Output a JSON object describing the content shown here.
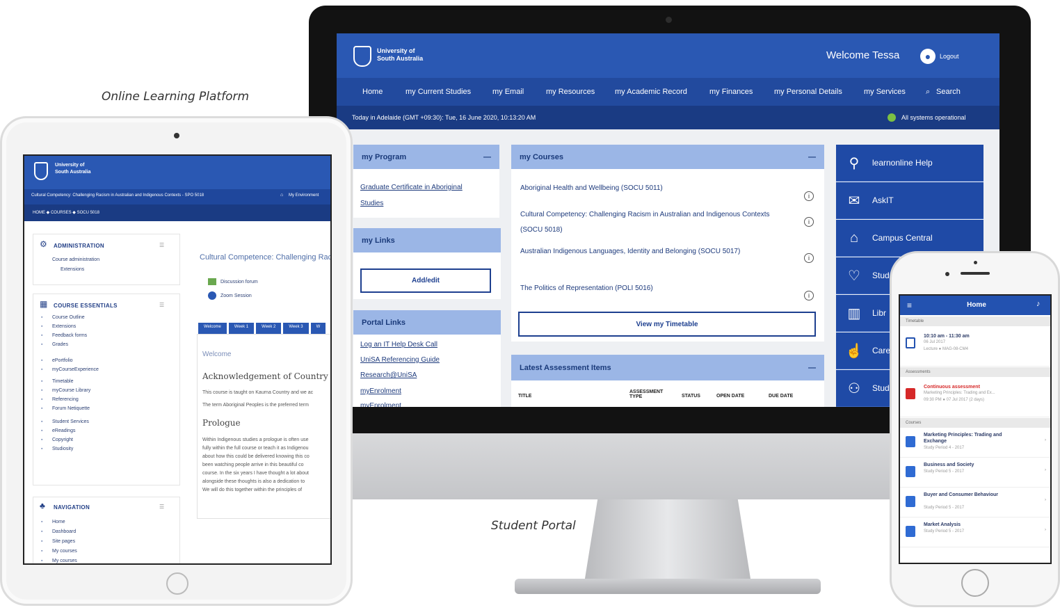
{
  "captions": {
    "online_learning": "Online Learning Platform",
    "student_portal": "Student Portal"
  },
  "portal": {
    "logo_line1": "University of",
    "logo_line2": "South Australia",
    "welcome": "Welcome Tessa",
    "logout": "Logout",
    "nav": [
      "Home",
      "my Current Studies",
      "my Email",
      "my Resources",
      "my Academic Record",
      "my Finances",
      "my Personal Details",
      "my Services",
      "Search"
    ],
    "status_left": "Today in Adelaide (GMT +09:30):   Tue, 16 June 2020, 10:13:20 AM",
    "status_right": "All systems operational",
    "my_program": {
      "title": "my Program",
      "link": "Graduate Certificate in Aboriginal Studies"
    },
    "my_links": {
      "title": "my Links",
      "button": "Add/edit"
    },
    "portal_links": {
      "title": "Portal Links",
      "items": [
        "Log an IT Help Desk Call",
        "UniSA Referencing Guide",
        "Research@UniSA",
        "myEnrolment",
        "myEnrolment"
      ]
    },
    "my_courses": {
      "title": "my Courses",
      "items": [
        "Aboriginal Health and Wellbeing (SOCU 5011)",
        "Cultural Competency: Challenging Racism in Australian and Indigenous Contexts (SOCU 5018)",
        "Australian Indigenous Languages, Identity and Belonging (SOCU 5017)",
        "The Politics of Representation (POLI 5016)"
      ],
      "button": "View my Timetable"
    },
    "assessment": {
      "title": "Latest Assessment Items",
      "columns": [
        "TITLE",
        "ASSESSMENT TYPE",
        "STATUS",
        "OPEN DATE",
        "DUE DATE"
      ]
    },
    "tiles": [
      "learnonline Help",
      "AskIT",
      "Campus Central",
      "Stud",
      "Libr",
      "Care",
      "Stud"
    ]
  },
  "lms": {
    "logo_line1": "University of",
    "logo_line2": "South Australia",
    "course_bar": "Cultural Competency: Challenging Racism in Australian and Indigenous Contexts - SPO 5018",
    "environment": "My Environment",
    "breadcrumb": "HOME  ◆  COURSES  ◆  SOCU 5018",
    "admin": {
      "title": "ADMINISTRATION",
      "items": [
        "Course administration",
        "Extensions"
      ]
    },
    "essentials": {
      "title": "COURSE ESSENTIALS",
      "items": [
        "Course Outline",
        "Extensions",
        "Feedback forms",
        "Grades",
        "ePortfolio",
        "myCourseExperience",
        "Timetable",
        "myCourse Library",
        "Referencing",
        "Forum Netiquette",
        "Student Services",
        "eReadings",
        "Copyright",
        "Studiosity"
      ]
    },
    "navigation": {
      "title": "NAVIGATION",
      "items": [
        "Home",
        "Dashboard",
        "Site pages",
        "My courses",
        "My courses"
      ]
    },
    "course_title": "Cultural Competence: Challenging Racism in...",
    "activities": [
      "Discussion forum",
      "Zoom Session"
    ],
    "tabs": [
      "Welcome",
      "Week 1",
      "Week 2",
      "Week 3",
      "W"
    ],
    "welcome": "Welcome",
    "ack_title": "Acknowledgement of Country and us",
    "ack_lines": [
      "This course is taught on Kaurna Country and we ac",
      "The term Aboriginal Peoples is the preferred term"
    ],
    "prologue": "Prologue",
    "prologue_lines": [
      "Within Indigenous studies a prologue is often use",
      "fully within the full course or teach it as Indigenou",
      "about how this could be delivered knowing this co",
      "been watching people arrive in this beautiful co",
      "course. In the six years I have thought a lot about",
      "alongside these thoughts is also a dedication to",
      "We will do this together within the principles of"
    ]
  },
  "mobile": {
    "title": "Home",
    "sections": [
      "Timetable",
      "Assessments",
      "Courses"
    ],
    "timetable": {
      "time": "10:10 am - 11:30 am",
      "date": "06 Jul 2017",
      "detail": "Lecture ● MAG-08-CM4"
    },
    "assessment": {
      "title": "Continuous assessment",
      "sub": "Marketing Principles: Trading and Ex...",
      "due": "09:30 PM ● 07 Jul 2017 (2 days)"
    },
    "courses": [
      {
        "title": "Marketing Principles: Trading and Exchange",
        "sub": "Study Period 4 - 2017"
      },
      {
        "title": "Business and Society",
        "sub": "Study Period 5 - 2017"
      },
      {
        "title": "Buyer and Consumer Behaviour",
        "sub": "Study Period 5 - 2017"
      },
      {
        "title": "Market Analysis",
        "sub": "Study Period 5 - 2017"
      }
    ]
  },
  "colors": {
    "portal_blue": "#2a58b3",
    "panel_header": "#9bb6e6",
    "tile_blue": "#1f4aa6",
    "status_green": "#7bc043",
    "alert_red": "#d62828"
  }
}
